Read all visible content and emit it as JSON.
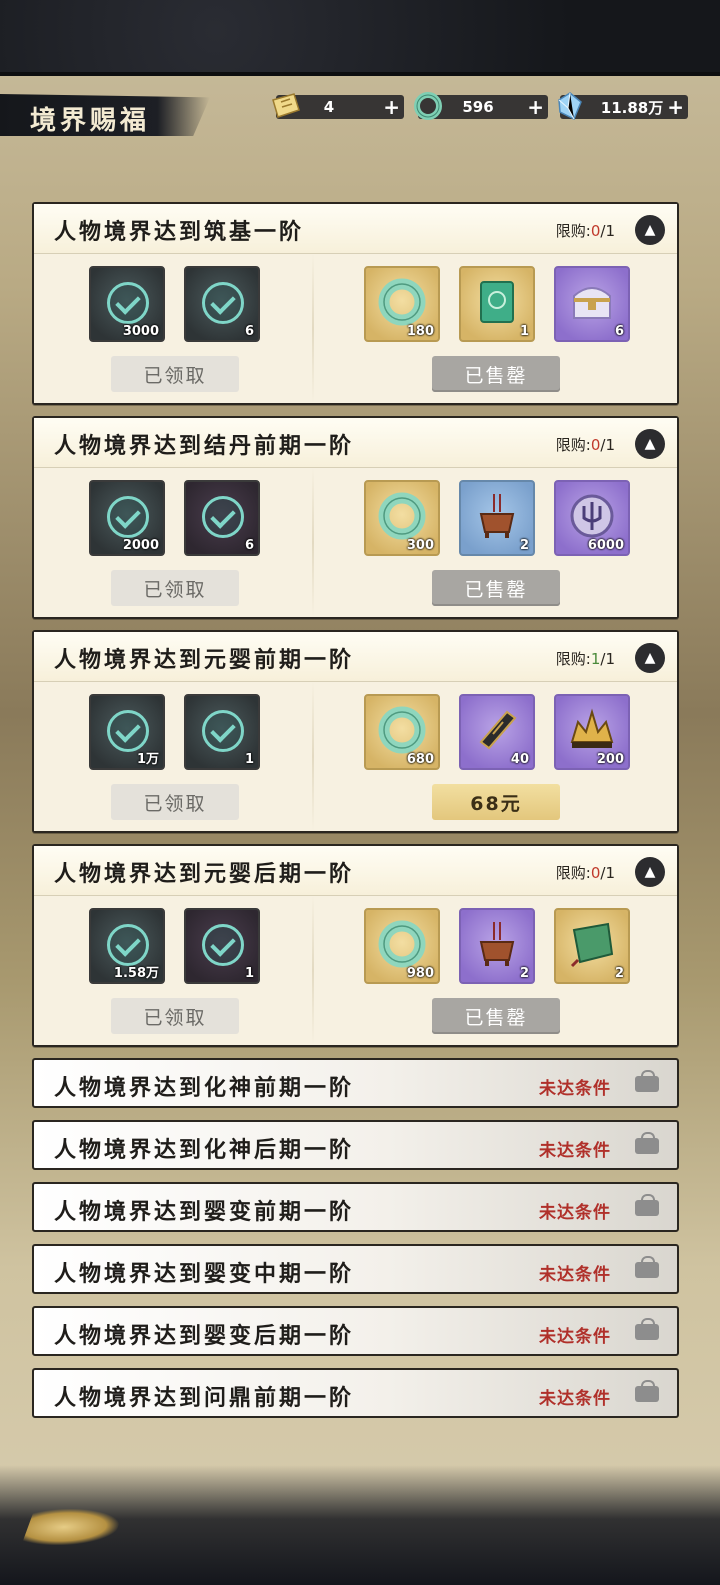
{
  "header": {
    "title": "境界赐福",
    "currencies": [
      {
        "icon": "ticket-icon",
        "value": "4"
      },
      {
        "icon": "jade-ring-icon",
        "value": "596"
      },
      {
        "icon": "spirit-crystal-icon",
        "value": "11.88万"
      }
    ],
    "plus": "+"
  },
  "cards": [
    {
      "title": "人物境界达到筑基一阶",
      "limit_label": "限购:",
      "limit_count": "0",
      "limit_total": "/1",
      "free_items": [
        {
          "icon": "spirit-stone-icon",
          "qty": "3000"
        },
        {
          "icon": "herb-bundle-icon",
          "qty": "6"
        }
      ],
      "free_button": "已领取",
      "paid_items": [
        {
          "icon": "jade-ring-icon",
          "qty": "180"
        },
        {
          "icon": "green-book-icon",
          "qty": "1"
        },
        {
          "icon": "treasure-chest-icon",
          "qty": "6"
        }
      ],
      "paid_button": "已售罄"
    },
    {
      "title": "人物境界达到结丹前期一阶",
      "limit_label": "限购:",
      "limit_count": "0",
      "limit_total": "/1",
      "free_items": [
        {
          "icon": "spirit-ore-icon",
          "qty": "2000"
        },
        {
          "icon": "purple-herb-icon",
          "qty": "6"
        }
      ],
      "free_button": "已领取",
      "paid_items": [
        {
          "icon": "jade-ring-icon",
          "qty": "300"
        },
        {
          "icon": "incense-burner-icon",
          "qty": "2"
        },
        {
          "icon": "trident-emblem-icon",
          "qty": "6000"
        }
      ],
      "paid_button": "已售罄"
    },
    {
      "title": "人物境界达到元婴前期一阶",
      "limit_label": "限购:",
      "limit_count": "1",
      "limit_total": "/1",
      "free_items": [
        {
          "icon": "spirit-stone-icon",
          "qty": "1万"
        },
        {
          "icon": "mystery-item-icon",
          "qty": "1"
        }
      ],
      "free_button": "已领取",
      "paid_items": [
        {
          "icon": "jade-ring-icon",
          "qty": "680"
        },
        {
          "icon": "talisman-icon",
          "qty": "40"
        },
        {
          "icon": "golden-crown-icon",
          "qty": "200"
        }
      ],
      "paid_button": "68元"
    },
    {
      "title": "人物境界达到元婴后期一阶",
      "limit_label": "限购:",
      "limit_count": "0",
      "limit_total": "/1",
      "free_items": [
        {
          "icon": "spirit-stone-icon",
          "qty": "1.58万"
        },
        {
          "icon": "scroll-book-icon",
          "qty": "1"
        }
      ],
      "free_button": "已领取",
      "paid_items": [
        {
          "icon": "jade-ring-icon",
          "qty": "980"
        },
        {
          "icon": "incense-burner-icon",
          "qty": "2"
        },
        {
          "icon": "green-scroll-icon",
          "qty": "2"
        }
      ],
      "paid_button": "已售罄"
    }
  ],
  "locked_rows": [
    {
      "title": "人物境界达到化神前期一阶",
      "status": "未达条件"
    },
    {
      "title": "人物境界达到化神后期一阶",
      "status": "未达条件"
    },
    {
      "title": "人物境界达到婴变前期一阶",
      "status": "未达条件"
    },
    {
      "title": "人物境界达到婴变中期一阶",
      "status": "未达条件"
    },
    {
      "title": "人物境界达到婴变后期一阶",
      "status": "未达条件"
    },
    {
      "title": "人物境界达到问鼎前期一阶",
      "status": "未达条件"
    }
  ],
  "colors": {
    "limit_zero": "#c0392b",
    "limit_ok": "#4a8a3a",
    "status_red": "#b0302a",
    "gold_button": "#e3c77d"
  }
}
